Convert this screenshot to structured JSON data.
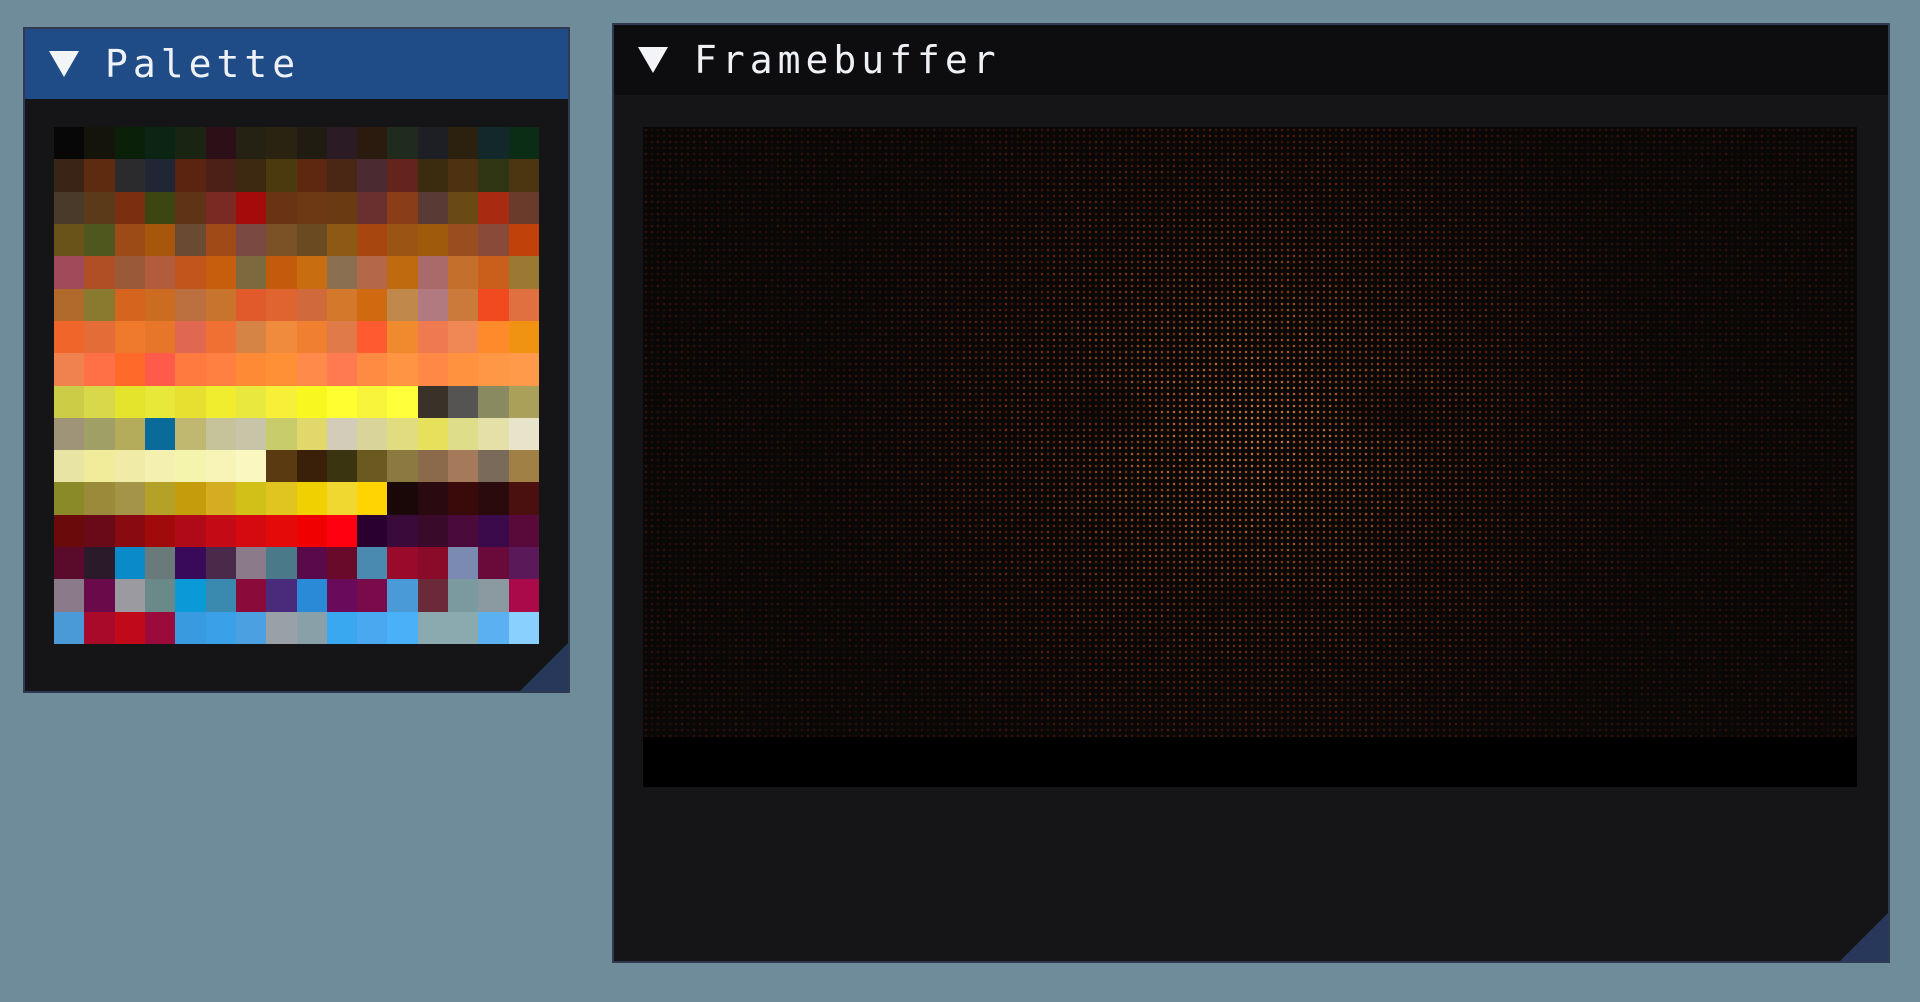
{
  "palette_window": {
    "title": "Palette",
    "collapse_icon": "triangle-down-icon",
    "resize_icon": "resize-grip-icon",
    "colors": [
      "#070707",
      "#15140b",
      "#0a2008",
      "#0b2414",
      "#1a2412",
      "#2c0f17",
      "#262213",
      "#2a2312",
      "#201c12",
      "#2a1b24",
      "#2b1a0e",
      "#1f2b1c",
      "#1d1f24",
      "#2c210e",
      "#13282a",
      "#0b2d16",
      "#3a2416",
      "#5e2a10",
      "#2b2a2d",
      "#202634",
      "#5a2411",
      "#4b2016",
      "#3d2812",
      "#4b3a0d",
      "#5e2710",
      "#4a2614",
      "#4b2a32",
      "#64231c",
      "#3b2c10",
      "#4d3110",
      "#303514",
      "#4b3611",
      "#4a3a2a",
      "#5a3a18",
      "#7a2f10",
      "#3d4512",
      "#5e3316",
      "#7a2a22",
      "#a40c0c",
      "#6a3313",
      "#6c3914",
      "#6a3a12",
      "#6a3030",
      "#8a3e17",
      "#5a3a35",
      "#6a4a14",
      "#a82a10",
      "#6a3a2a",
      "#6a5318",
      "#4f561e",
      "#9c4a16",
      "#a8560c",
      "#6a4a32",
      "#a04a17",
      "#7a4a42",
      "#7a5226",
      "#6a4a20",
      "#8c5a14",
      "#a8460f",
      "#9a5414",
      "#a05a0c",
      "#9a4e20",
      "#8a4a3a",
      "#c0420a",
      "#a04a5a",
      "#b04e26",
      "#9a5a3a",
      "#b35c3d",
      "#c0561c",
      "#c55e0d",
      "#7c6a3e",
      "#c25c0c",
      "#c86e10",
      "#8a7050",
      "#b4684a",
      "#c06a10",
      "#aa6a6a",
      "#c4702c",
      "#c8601c",
      "#9a7a32",
      "#b06a2c",
      "#8a7a30",
      "#d4641e",
      "#cc6c20",
      "#bc7040",
      "#c8742c",
      "#e05a2c",
      "#e06430",
      "#d06a3c",
      "#d4782c",
      "#d06a10",
      "#c0884a",
      "#b07a80",
      "#cc7a3c",
      "#f04a1e",
      "#e07040",
      "#f0662a",
      "#e46c36",
      "#f07a2c",
      "#e8762a",
      "#e06850",
      "#f07034",
      "#d68446",
      "#f08a3c",
      "#f08030",
      "#e07a48",
      "#ff5a30",
      "#f08a2e",
      "#f07a50",
      "#f08856",
      "#ff8a2a",
      "#f09212",
      "#f08250",
      "#ff7046",
      "#ff6a2a",
      "#ff5a4a",
      "#ff7a3e",
      "#ff8040",
      "#ff8a36",
      "#ff9036",
      "#ff8a4a",
      "#ff7a50",
      "#ff8a42",
      "#ff9442",
      "#ff8846",
      "#ff923e",
      "#ff9846",
      "#ff9a4a",
      "#cccc46",
      "#d8d84a",
      "#e4e42c",
      "#e8e83a",
      "#e8e030",
      "#f0ec2e",
      "#e8e83e",
      "#f8f038",
      "#f8f820",
      "#ffff30",
      "#f8f43c",
      "#ffff3a",
      "#3a3228",
      "#565452",
      "#8a8a60",
      "#aaa05a",
      "#a09478",
      "#a0a066",
      "#b4ac5a",
      "#0a6a9a",
      "#c0b870",
      "#c6c29a",
      "#c8c4a8",
      "#c8cc6a",
      "#e0d86a",
      "#d2ccb8",
      "#d8d49a",
      "#e2dc80",
      "#e6e05a",
      "#dede8a",
      "#e4e0a8",
      "#e8e4cc",
      "#e8e4a4",
      "#f0ec9a",
      "#f0eca8",
      "#f4f0b0",
      "#f4f4ac",
      "#f8f4b8",
      "#faf8c0",
      "#5a3a10",
      "#3a2008",
      "#3a3410",
      "#6a5a20",
      "#8a7a40",
      "#8a6a4a",
      "#a47a5a",
      "#7a6a5a",
      "#a08044",
      "#8a8a28",
      "#9a8a3a",
      "#a49448",
      "#b4a228",
      "#c49c0c",
      "#d4ae20",
      "#d0c018",
      "#e0c420",
      "#f0d000",
      "#f0d830",
      "#ffd400",
      "#1a0808",
      "#2a0a10",
      "#3a0a0a",
      "#2a0a0a",
      "#4a1010",
      "#6a0a0a",
      "#6a0a18",
      "#8a0a12",
      "#a00a0a",
      "#b00a18",
      "#c40a14",
      "#d40a10",
      "#e40a0a",
      "#f00000",
      "#ff0010",
      "#2a0030",
      "#3a0a3a",
      "#3a0a2a",
      "#4a0a3a",
      "#3a0a4a",
      "#5a0a3a",
      "#5a0a2a",
      "#2a1a2a",
      "#0a8ac8",
      "#6a7a7a",
      "#3a0a5a",
      "#4a2a4a",
      "#8a7a8a",
      "#4a7a8a",
      "#5a0a4a",
      "#6a0a2a",
      "#4a8ab0",
      "#9a0a2a",
      "#8a0a2a",
      "#7a8ab0",
      "#6a0a3a",
      "#5a1a5a",
      "#8a7a8a",
      "#6a0a4a",
      "#9a9aa0",
      "#6a8a8a",
      "#0a9ad8",
      "#3a8ab0",
      "#8a0a3a",
      "#4a2a7a",
      "#2a8ad8",
      "#6a0a5a",
      "#7a0a4a",
      "#4a9ad8",
      "#6a2a3a",
      "#7a9aa0",
      "#8a9aa0",
      "#aa0a4a",
      "#4a9ad8",
      "#aa0a2a",
      "#c00a1a",
      "#9a0a3a",
      "#3a9ae0",
      "#3aa0e8",
      "#4aa0e0",
      "#9aa0a8",
      "#8aa0a8",
      "#3aa8f0",
      "#4aa8f0",
      "#4ab0f8",
      "#8aaab0",
      "#8aaab0",
      "#5ab0f0",
      "#8ad0ff"
    ]
  },
  "framebuffer_window": {
    "title": "Framebuffer",
    "collapse_icon": "triangle-down-icon",
    "resize_icon": "resize-grip-icon",
    "image": "dithered-face-image"
  }
}
